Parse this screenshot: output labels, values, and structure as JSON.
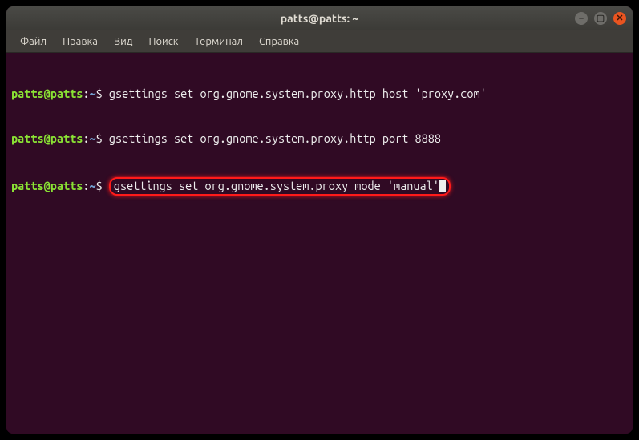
{
  "window": {
    "title": "patts@patts: ~"
  },
  "menubar": {
    "items": [
      "Файл",
      "Правка",
      "Вид",
      "Поиск",
      "Терминал",
      "Справка"
    ]
  },
  "prompt": {
    "userhost": "patts@patts",
    "path": "~",
    "sep": ":",
    "sigil": "$"
  },
  "lines": [
    {
      "cmd": " gsettings set org.gnome.system.proxy.http host 'proxy.com'",
      "highlight": false
    },
    {
      "cmd": "gsettings set org.gnome.system.proxy.http port 8888",
      "highlight": false
    },
    {
      "cmd": "gsettings set org.gnome.system.proxy mode 'manual'",
      "highlight": true,
      "cursor": true
    }
  ],
  "icons": {
    "min": "–",
    "max": "▢",
    "close": "✕"
  }
}
